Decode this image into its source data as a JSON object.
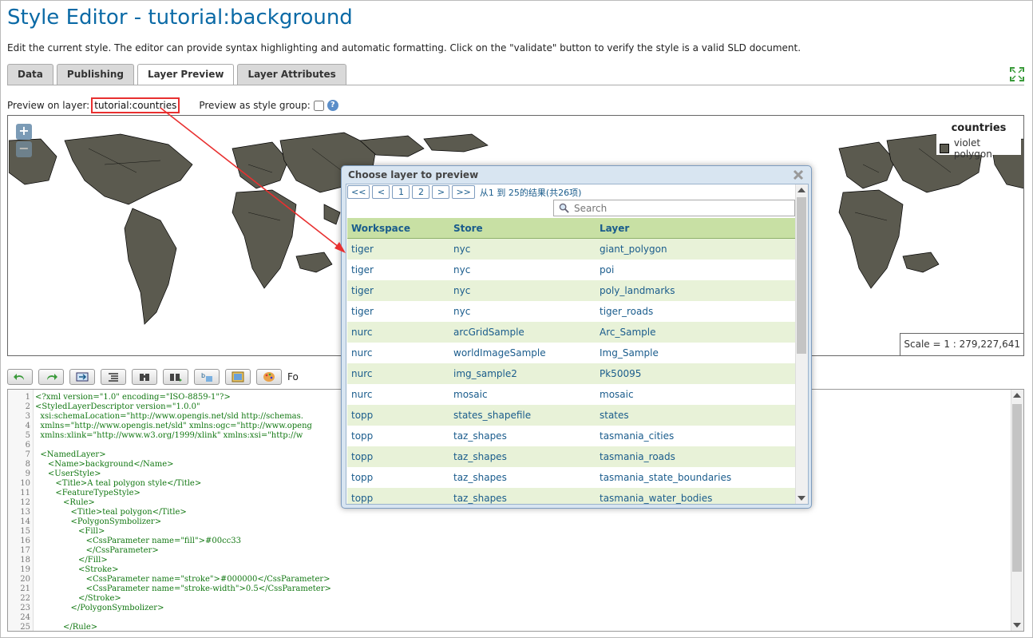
{
  "page": {
    "title": "Style Editor - tutorial:background",
    "description": "Edit the current style. The editor can provide syntax highlighting and automatic formatting. Click on the \"validate\" button to verify the style is a valid SLD document."
  },
  "tabs": [
    {
      "label": "Data"
    },
    {
      "label": "Publishing"
    },
    {
      "label": "Layer Preview"
    },
    {
      "label": "Layer Attributes"
    }
  ],
  "preview": {
    "layer_label": "Preview on layer:",
    "layer_value": "tutorial:countries",
    "style_group_label": "Preview as style group:",
    "help_glyph": "?"
  },
  "map": {
    "zoom_in": "+",
    "zoom_out": "−",
    "legend_title": "countries",
    "legend_item": "violet polygon",
    "legend_color": "#5b5a4f",
    "scale": "Scale = 1 : 279,227,641"
  },
  "toolbar": {
    "format_label": "Fo"
  },
  "editor": {
    "line_numbers": [
      "1",
      "2",
      "3",
      "4",
      "5",
      "6",
      "7",
      "8",
      "9",
      "10",
      "11",
      "12",
      "13",
      "14",
      "15",
      "16",
      "17",
      "18",
      "19",
      "20",
      "21",
      "22",
      "23",
      "24",
      "25"
    ],
    "lines": [
      "<?xml version=\"1.0\" encoding=\"ISO-8859-1\"?>",
      "<StyledLayerDescriptor version=\"1.0.0\"",
      "  xsi:schemaLocation=\"http://www.opengis.net/sld http://schemas.",
      "  xmlns=\"http://www.opengis.net/sld\" xmlns:ogc=\"http://www.openg",
      "  xmlns:xlink=\"http://www.w3.org/1999/xlink\" xmlns:xsi=\"http://w",
      "",
      "  <NamedLayer>",
      "     <Name>background</Name>",
      "     <UserStyle>",
      "        <Title>A teal polygon style</Title>",
      "        <FeatureTypeStyle>",
      "           <Rule>",
      "              <Title>teal polygon</Title>",
      "              <PolygonSymbolizer>",
      "                 <Fill>",
      "                    <CssParameter name=\"fill\">#00cc33",
      "                    </CssParameter>",
      "                 </Fill>",
      "                 <Stroke>",
      "                    <CssParameter name=\"stroke\">#000000</CssParameter>",
      "                    <CssParameter name=\"stroke-width\">0.5</CssParameter>",
      "                 </Stroke>",
      "              </PolygonSymbolizer>",
      "",
      "           </Rule>"
    ]
  },
  "dialog": {
    "title": "Choose layer to preview",
    "pager": {
      "first": "<<",
      "prev": "<",
      "page1": "1",
      "page2": "2",
      "next": ">",
      "last": ">>",
      "info": "从1 到 25的结果(共26项)"
    },
    "search_placeholder": "Search",
    "columns": [
      "Workspace",
      "Store",
      "Layer"
    ],
    "rows": [
      [
        "tiger",
        "nyc",
        "giant_polygon"
      ],
      [
        "tiger",
        "nyc",
        "poi"
      ],
      [
        "tiger",
        "nyc",
        "poly_landmarks"
      ],
      [
        "tiger",
        "nyc",
        "tiger_roads"
      ],
      [
        "nurc",
        "arcGridSample",
        "Arc_Sample"
      ],
      [
        "nurc",
        "worldImageSample",
        "Img_Sample"
      ],
      [
        "nurc",
        "img_sample2",
        "Pk50095"
      ],
      [
        "nurc",
        "mosaic",
        "mosaic"
      ],
      [
        "topp",
        "states_shapefile",
        "states"
      ],
      [
        "topp",
        "taz_shapes",
        "tasmania_cities"
      ],
      [
        "topp",
        "taz_shapes",
        "tasmania_roads"
      ],
      [
        "topp",
        "taz_shapes",
        "tasmania_state_boundaries"
      ],
      [
        "topp",
        "taz_shapes",
        "tasmania_water_bodies"
      ]
    ]
  },
  "colors": {
    "title": "#0b6aa6",
    "annotation": "#e83030",
    "row_alt": "#e8f2d8",
    "header": "#c8e0a4"
  }
}
